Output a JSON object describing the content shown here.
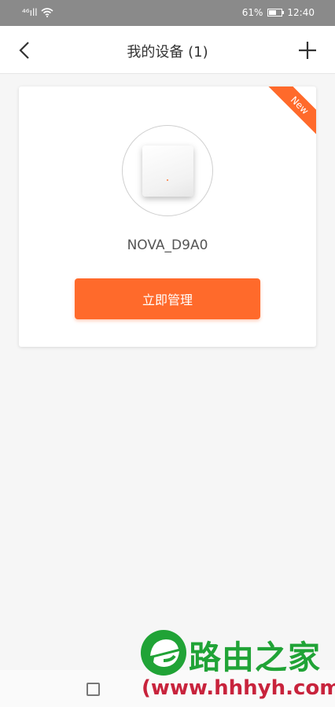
{
  "status_bar": {
    "signal_text": "⁴⁶ıll",
    "battery_percent": "61%",
    "time": "12:40",
    "battery_level": 0.61
  },
  "header": {
    "title": "我的设备 (1)",
    "back_icon": "chevron-left-icon",
    "add_icon": "plus-icon"
  },
  "device_card": {
    "badge": "New",
    "device_name": "NOVA_D9A0",
    "manage_label": "立即管理",
    "accent_color": "#ff6a2b"
  },
  "watermark": {
    "title": "路由之家",
    "url": "(www.hhhyh.com)",
    "brand_color": "#20a336",
    "url_color": "#c8233c"
  },
  "system_nav": {
    "recent_icon": "square-icon"
  }
}
